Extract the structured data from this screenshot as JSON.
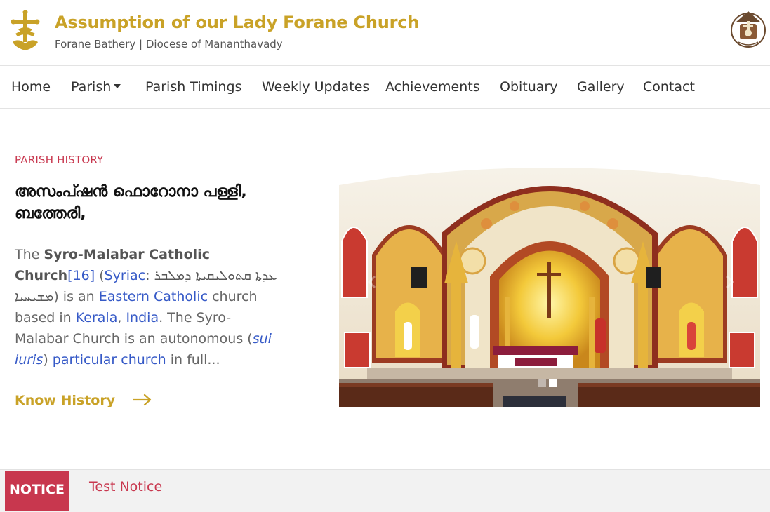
{
  "header": {
    "title": "Assumption of our Lady Forane Church",
    "subtitle": "Forane Bathery | Diocese of Mananthavady"
  },
  "nav": {
    "items": [
      "Home",
      "Parish",
      "Parish Timings",
      "Weekly Updates",
      "Achievements",
      "Obituary",
      "Gallery",
      "Contact"
    ]
  },
  "history": {
    "label": "PARISH HISTORY",
    "heading": "അസംപ്ഷൻ ഫൊറോനാ പള്ളി, ബത്തേരി,",
    "text": {
      "p1": "The ",
      "p2": "Syro-Malabar Catholic Church",
      "p3": "[16]",
      "p4": " (",
      "p5": "Syriac",
      "p6": ": ܥܕܬܐ ܩܬܘܠܝܩܝܬܐ ܕܡܠܒܪ ܡܫܝܚܝܐ",
      "p7": ") is an ",
      "p8": "Eastern Catholic",
      "p9": " church based in ",
      "p10": "Kerala",
      "p11": ", ",
      "p12": "India",
      "p13": ". The Syro-Malabar Church is an autonomous (",
      "p14": "sui iuris",
      "p15": ") ",
      "p16": "particular church",
      "p17": " in full..."
    },
    "link_label": "Know History"
  },
  "carousel": {
    "slide_count": 2,
    "active_slide": 2
  },
  "notice": {
    "label": "NOTICE",
    "text": "Test Notice"
  },
  "colors": {
    "gold": "#c9a227",
    "crimson": "#c8374e",
    "link_blue": "#3559c7"
  },
  "icons": [
    "cross-logo-icon",
    "diocese-seal-icon",
    "chevron-down-icon",
    "arrow-right-icon",
    "chevron-left-icon",
    "chevron-right-icon"
  ]
}
